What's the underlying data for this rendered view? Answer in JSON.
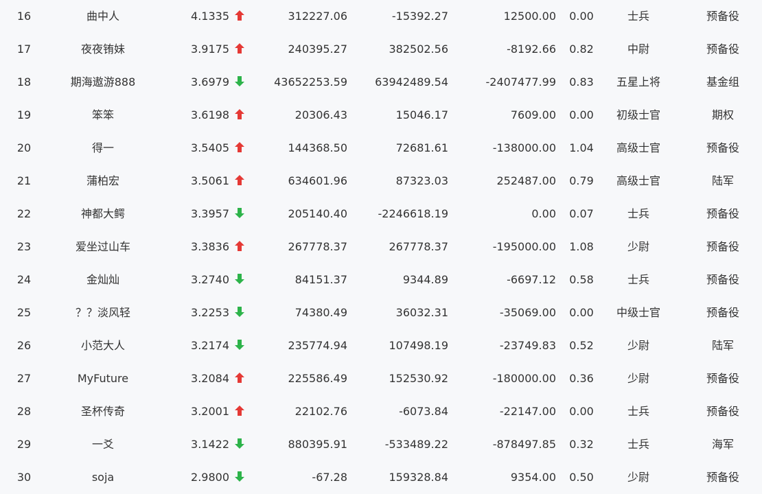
{
  "colors": {
    "up": "#e53935",
    "down": "#2db34a",
    "text": "#333333",
    "background": "#f7f8fa"
  },
  "rows": [
    {
      "rank": "16",
      "name": "曲中人",
      "score": "4.1335",
      "trend": "up",
      "v1": "312227.06",
      "v2": "-15392.27",
      "v3": "12500.00",
      "ratio": "0.00",
      "title": "士兵",
      "group": "预备役"
    },
    {
      "rank": "17",
      "name": "夜夜铕妹",
      "score": "3.9175",
      "trend": "up",
      "v1": "240395.27",
      "v2": "382502.56",
      "v3": "-8192.66",
      "ratio": "0.82",
      "title": "中尉",
      "group": "预备役"
    },
    {
      "rank": "18",
      "name": "期海遨游888",
      "score": "3.6979",
      "trend": "down",
      "v1": "43652253.59",
      "v2": "63942489.54",
      "v3": "-2407477.99",
      "ratio": "0.83",
      "title": "五星上将",
      "group": "基金组"
    },
    {
      "rank": "19",
      "name": "笨笨",
      "score": "3.6198",
      "trend": "up",
      "v1": "20306.43",
      "v2": "15046.17",
      "v3": "7609.00",
      "ratio": "0.00",
      "title": "初级士官",
      "group": "期权"
    },
    {
      "rank": "20",
      "name": "得一",
      "score": "3.5405",
      "trend": "up",
      "v1": "144368.50",
      "v2": "72681.61",
      "v3": "-138000.00",
      "ratio": "1.04",
      "title": "高级士官",
      "group": "预备役"
    },
    {
      "rank": "21",
      "name": "蒲柏宏",
      "score": "3.5061",
      "trend": "up",
      "v1": "634601.96",
      "v2": "87323.03",
      "v3": "252487.00",
      "ratio": "0.79",
      "title": "高级士官",
      "group": "陆军"
    },
    {
      "rank": "22",
      "name": "神都大鳄",
      "score": "3.3957",
      "trend": "down",
      "v1": "205140.40",
      "v2": "-2246618.19",
      "v3": "0.00",
      "ratio": "0.07",
      "title": "士兵",
      "group": "预备役"
    },
    {
      "rank": "23",
      "name": "爱坐过山车",
      "score": "3.3836",
      "trend": "up",
      "v1": "267778.37",
      "v2": "267778.37",
      "v3": "-195000.00",
      "ratio": "1.08",
      "title": "少尉",
      "group": "预备役"
    },
    {
      "rank": "24",
      "name": "金灿灿",
      "score": "3.2740",
      "trend": "down",
      "v1": "84151.37",
      "v2": "9344.89",
      "v3": "-6697.12",
      "ratio": "0.58",
      "title": "士兵",
      "group": "预备役"
    },
    {
      "rank": "25",
      "name": "？？淡风轻",
      "score": "3.2253",
      "trend": "down",
      "v1": "74380.49",
      "v2": "36032.31",
      "v3": "-35069.00",
      "ratio": "0.00",
      "title": "中级士官",
      "group": "预备役"
    },
    {
      "rank": "26",
      "name": "小范大人",
      "score": "3.2174",
      "trend": "down",
      "v1": "235774.94",
      "v2": "107498.19",
      "v3": "-23749.83",
      "ratio": "0.52",
      "title": "少尉",
      "group": "陆军"
    },
    {
      "rank": "27",
      "name": "MyFuture",
      "score": "3.2084",
      "trend": "up",
      "v1": "225586.49",
      "v2": "152530.92",
      "v3": "-180000.00",
      "ratio": "0.36",
      "title": "少尉",
      "group": "预备役"
    },
    {
      "rank": "28",
      "name": "圣杯传奇",
      "score": "3.2001",
      "trend": "up",
      "v1": "22102.76",
      "v2": "-6073.84",
      "v3": "-22147.00",
      "ratio": "0.00",
      "title": "士兵",
      "group": "预备役"
    },
    {
      "rank": "29",
      "name": "一爻",
      "score": "3.1422",
      "trend": "down",
      "v1": "880395.91",
      "v2": "-533489.22",
      "v3": "-878497.85",
      "ratio": "0.32",
      "title": "士兵",
      "group": "海军"
    },
    {
      "rank": "30",
      "name": "soja",
      "score": "2.9800",
      "trend": "down",
      "v1": "-67.28",
      "v2": "159328.84",
      "v3": "9354.00",
      "ratio": "0.50",
      "title": "少尉",
      "group": "预备役"
    }
  ]
}
